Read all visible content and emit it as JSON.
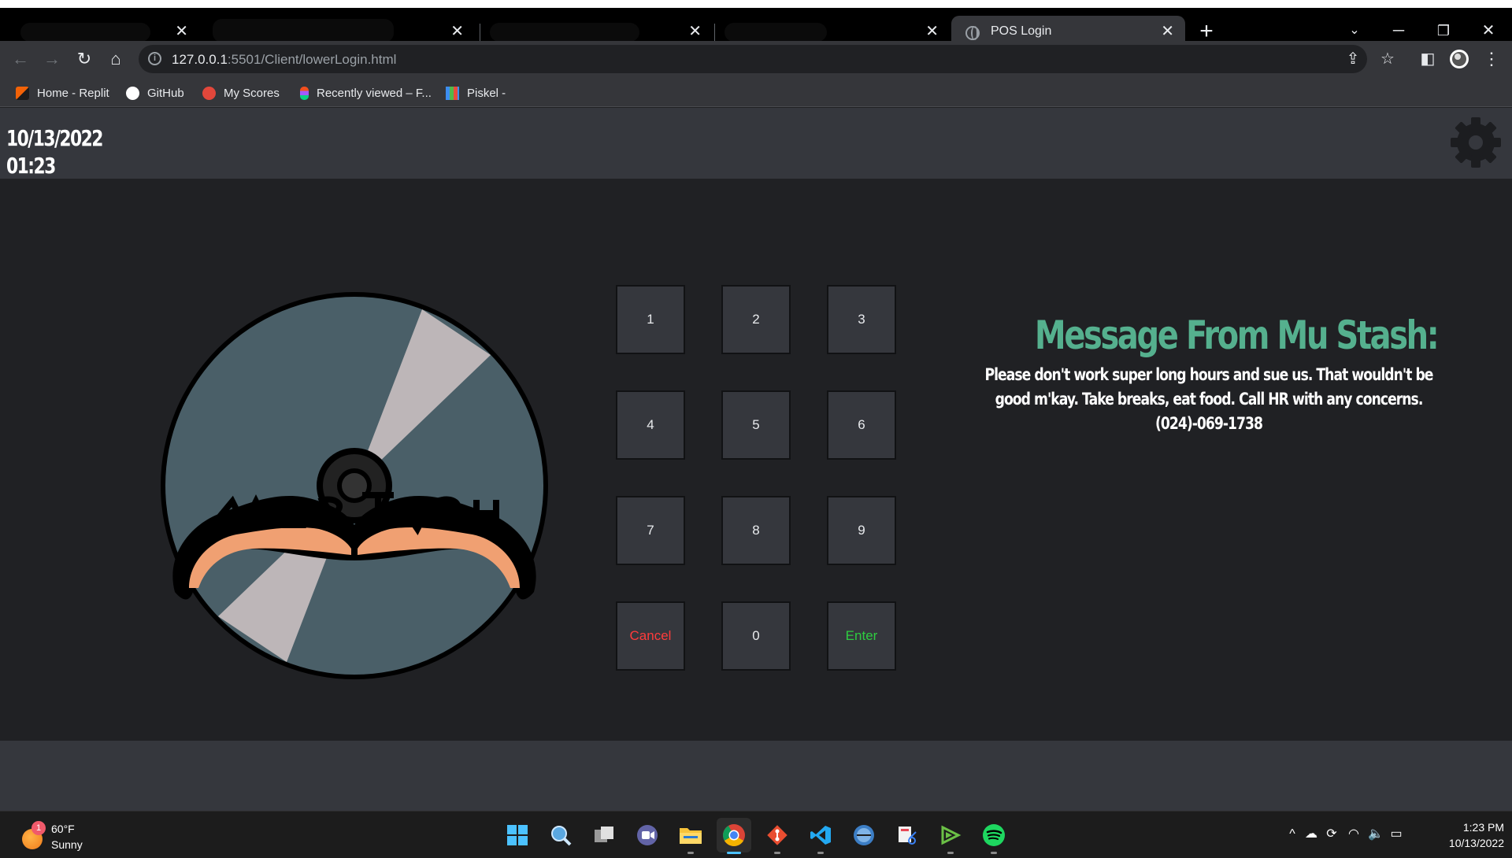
{
  "browser": {
    "tabs": [
      {
        "title": "",
        "redacted": true
      },
      {
        "title": "",
        "redacted": true
      },
      {
        "title": "",
        "redacted": true
      },
      {
        "title": "",
        "redacted": true
      },
      {
        "title": "POS Login",
        "redacted": false,
        "active": true
      }
    ],
    "url_host": "127.0.0.1",
    "url_rest": ":5501/Client/lowerLogin.html",
    "bookmarks": [
      "Home - Replit",
      "GitHub",
      "My Scores",
      "Recently viewed – F...",
      "Piskel -"
    ]
  },
  "header": {
    "date": "10/13/2022",
    "time": "01:23"
  },
  "keypad": {
    "keys": [
      "1",
      "2",
      "3",
      "4",
      "5",
      "6",
      "7",
      "8",
      "9",
      "Cancel",
      "0",
      "Enter"
    ]
  },
  "message": {
    "title": "Message From Mu Stash:",
    "body": "Please don't work super long hours and sue us. That wouldn't be good m'kay. Take breaks, eat food. Call HR with any concerns. (024)-069-1738"
  },
  "logo": {
    "text": "MUSTASH",
    "icon": "cd-disc-mustache-logo"
  },
  "taskbar": {
    "weather_temp": "60°F",
    "weather_cond": "Sunny",
    "weather_badge": "1",
    "clock_time": "1:23 PM",
    "clock_date": "10/13/2022",
    "apps": [
      "windows-start-icon",
      "search-icon",
      "task-view-icon",
      "teams-chat-icon",
      "file-explorer-icon",
      "chrome-icon",
      "git-icon",
      "vscode-icon",
      "browser-app-icon",
      "snipping-tool-icon",
      "vim-icon",
      "spotify-icon"
    ]
  },
  "colors": {
    "accent": "#55b08e",
    "cancel": "#ff3b3b",
    "enter": "#2ecc40",
    "panel": "#35373d",
    "background": "#202124"
  }
}
